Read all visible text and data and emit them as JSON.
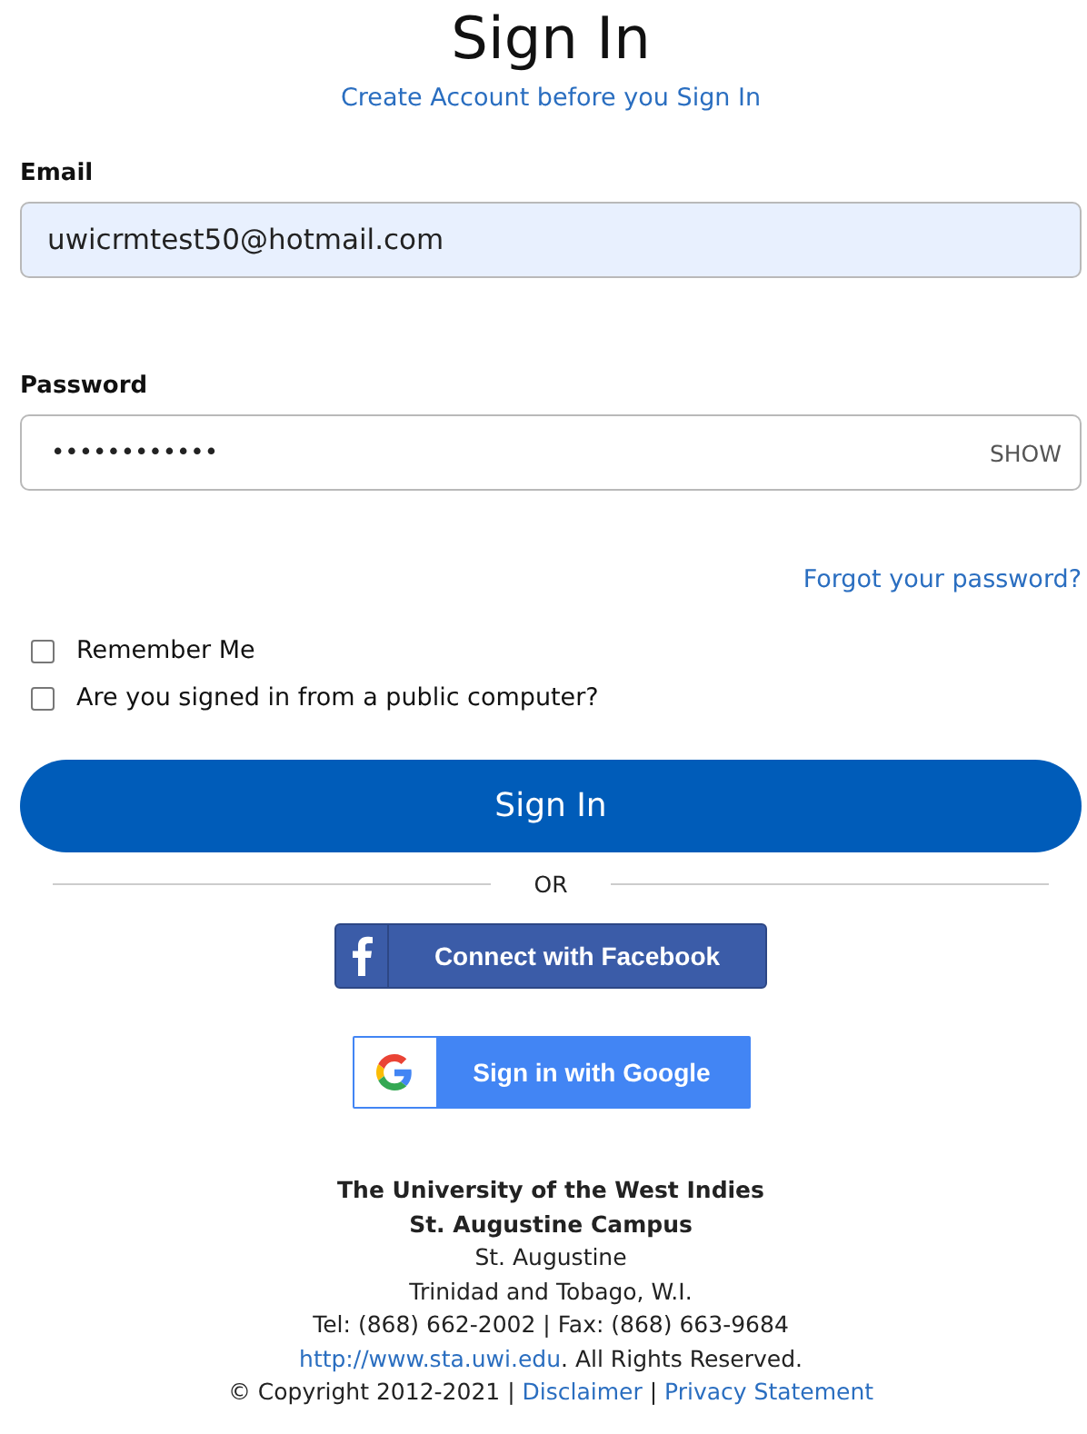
{
  "title": "Sign In",
  "create_account_link": "Create Account before you Sign In",
  "email": {
    "label": "Email",
    "value": "uwicrmtest50@hotmail.com",
    "autofilled": true
  },
  "password": {
    "label": "Password",
    "value": "••••••••••••",
    "toggle": "SHOW"
  },
  "forgot_link": "Forgot your password?",
  "checkboxes": [
    {
      "label": "Remember Me",
      "checked": false
    },
    {
      "label": "Are you signed in from a public computer?",
      "checked": false
    }
  ],
  "sign_in_button": "Sign In",
  "divider": "OR",
  "social_buttons": [
    {
      "kind": "facebook",
      "label": "Connect with Facebook"
    },
    {
      "kind": "google",
      "label": "Sign in with Google"
    }
  ],
  "footer": {
    "lines": [
      {
        "text": "The University of the West Indies",
        "bold": true
      },
      {
        "text": "St. Augustine Campus",
        "bold": true
      },
      {
        "text": "St. Augustine",
        "bold": false
      },
      {
        "text": "Trinidad and Tobago, W.I.",
        "bold": false
      },
      {
        "text": "Tel: (868) 662-2002 | Fax: (868) 663-9684",
        "bold": false
      }
    ],
    "link_lines": [
      [
        {
          "kind": "link",
          "text": "http://www.sta.uwi.edu"
        },
        {
          "kind": "text",
          "text": ". All Rights Reserved."
        }
      ],
      [
        {
          "kind": "text",
          "text": "© Copyright 2012-2021 | "
        },
        {
          "kind": "link",
          "text": "Disclaimer"
        },
        {
          "kind": "text",
          "text": " | "
        },
        {
          "kind": "link",
          "text": "Privacy Statement"
        }
      ]
    ]
  }
}
